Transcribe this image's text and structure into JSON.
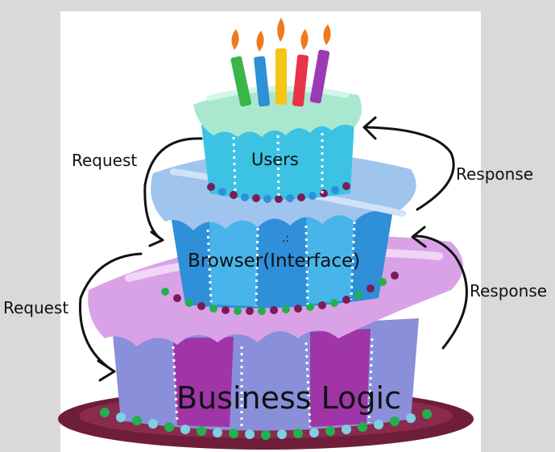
{
  "layers": {
    "top": "Users",
    "middle": "Browser(Interface)",
    "bottom": "Business Logic"
  },
  "arrows": {
    "request_upper": "Request",
    "request_lower": "Request",
    "response_upper": "Response",
    "response_lower": "Response"
  },
  "colors": {
    "top_tier": "#3cc3e4",
    "top_frosting": "#a9e8cf",
    "middle_tier": "#2f8fd8",
    "middle_frosting": "#9fc5ee",
    "bottom_tier": "#8a8fd9",
    "bottom_frosting": "#d9a2e6",
    "bottom_stripe": "#a035a8",
    "plate": "#6e1d3a"
  }
}
